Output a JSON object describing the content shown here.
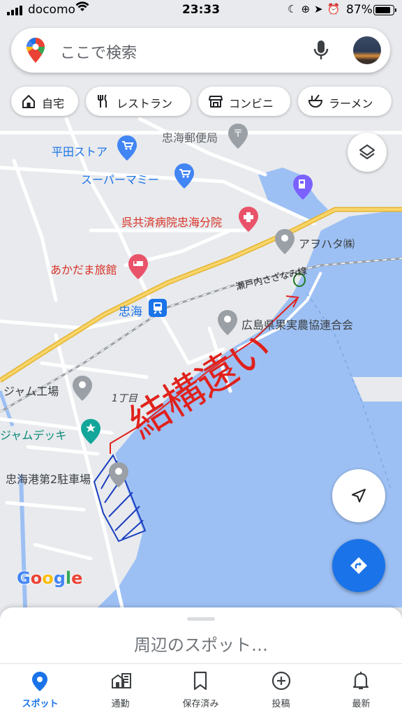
{
  "status_bar": {
    "carrier": "docomo",
    "time": "23:33",
    "battery": "87%"
  },
  "search": {
    "placeholder": "ここで検索"
  },
  "chips": [
    {
      "label": "自宅",
      "icon": "home-icon"
    },
    {
      "label": "レストラン",
      "icon": "restaurant-icon"
    },
    {
      "label": "コンビニ",
      "icon": "store-icon"
    },
    {
      "label": "ラーメン",
      "icon": "ramen-icon"
    }
  ],
  "map": {
    "places": {
      "post_office": "忠海郵便局",
      "hirata_store": "平田ストア",
      "super_mamy": "スーパーマミー",
      "hospital": "呉共済病院忠海分院",
      "anuhata": "アヲハタ㈱",
      "akadama": "あかだま旅館",
      "station": "忠海",
      "nokyo": "広島県果実農協連合会",
      "jam_factory": "ジャム工場",
      "chome": "1丁目",
      "jam_deck": "ジャムデッキ",
      "parking": "忠海港第2駐車場"
    },
    "rail_line": "瀬戸内さざなみ線",
    "handwriting": "結構遠い",
    "logo": "Google",
    "colors": {
      "water": "#9dc0f4",
      "land": "#e8eaed",
      "road_major": "#f7c94b",
      "annotation_red": "#e0211b",
      "annotation_blue": "#1b3fc0"
    }
  },
  "buttons": {
    "layers": "layers-icon",
    "my_location": "navigation-arrow-icon",
    "directions": "directions-icon"
  },
  "sheet": {
    "title": "周辺のスポット…"
  },
  "tabs": [
    {
      "label": "スポット",
      "icon": "location-pin-icon",
      "active": true
    },
    {
      "label": "通勤",
      "icon": "commute-icon",
      "active": false
    },
    {
      "label": "保存済み",
      "icon": "bookmark-icon",
      "active": false
    },
    {
      "label": "投稿",
      "icon": "add-circle-icon",
      "active": false
    },
    {
      "label": "最新",
      "icon": "bell-icon",
      "active": false
    }
  ]
}
